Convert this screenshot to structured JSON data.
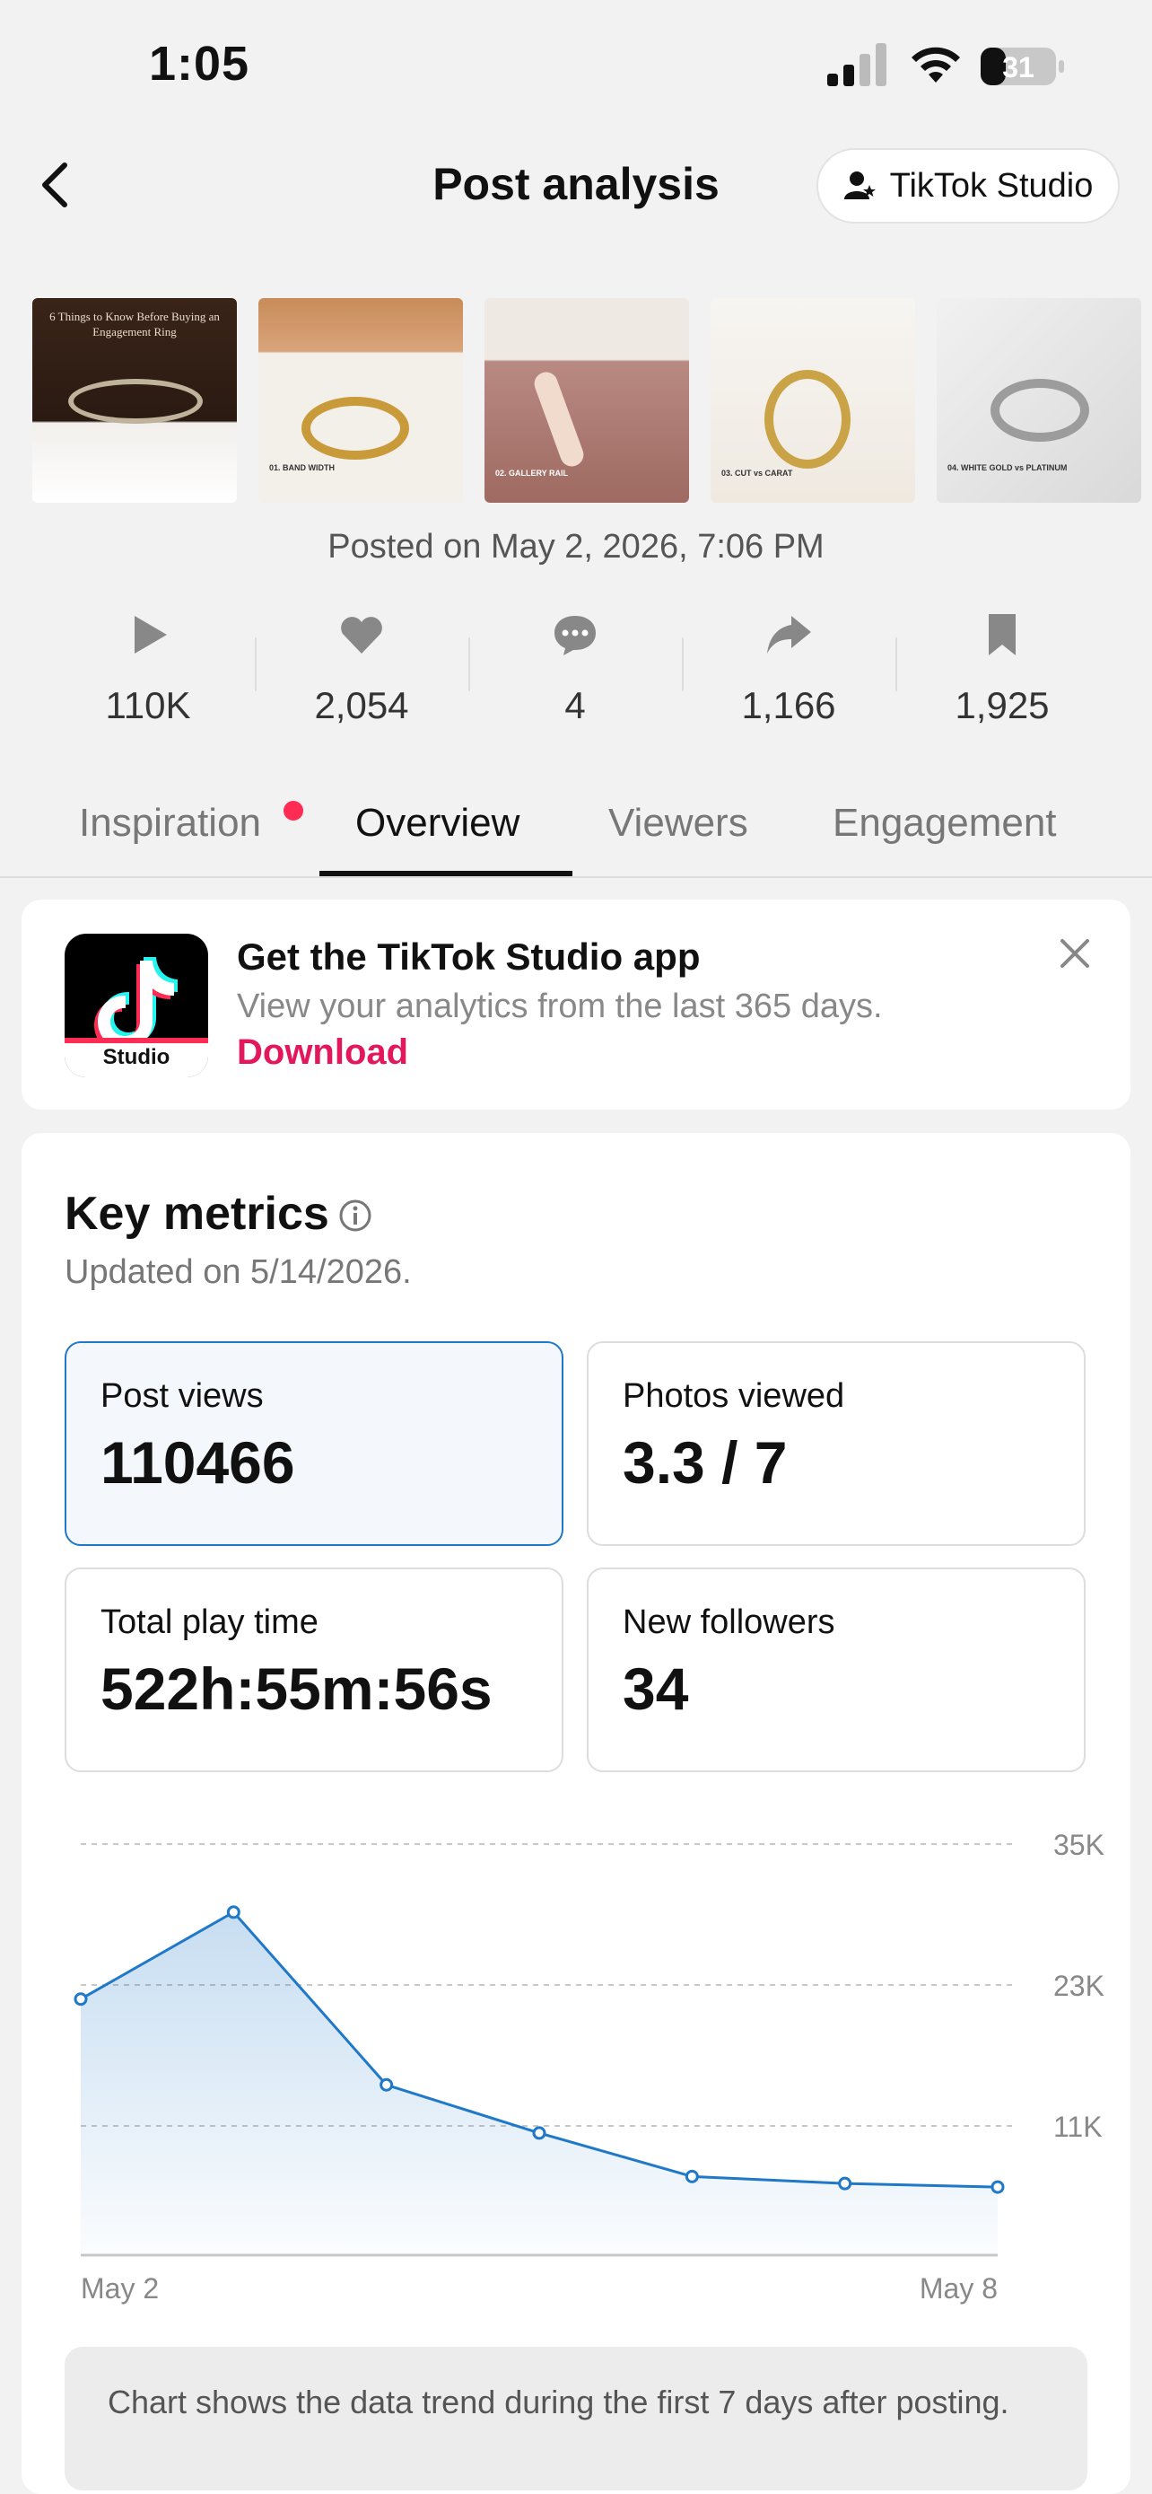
{
  "status_bar": {
    "time": "1:05",
    "battery": "31"
  },
  "header": {
    "title": "Post analysis",
    "studio_button": "TikTok Studio"
  },
  "thumbnails": [
    {
      "caption": "6 Things to Know Before Buying an Engagement Ring"
    },
    {
      "caption": "01. BAND WIDTH"
    },
    {
      "caption": "02. GALLERY RAIL"
    },
    {
      "caption": "03. CUT vs CARAT"
    },
    {
      "caption": "04. WHITE GOLD vs PLATINUM"
    }
  ],
  "posted": "Posted on May 2, 2026, 7:06 PM",
  "stats": [
    {
      "icon": "play-icon",
      "value": "110K"
    },
    {
      "icon": "heart-icon",
      "value": "2,054"
    },
    {
      "icon": "comment-icon",
      "value": "4"
    },
    {
      "icon": "share-icon",
      "value": "1,166"
    },
    {
      "icon": "bookmark-icon",
      "value": "1,925"
    }
  ],
  "tabs": [
    {
      "label": "Inspiration",
      "active": false,
      "badge": true
    },
    {
      "label": "Overview",
      "active": true
    },
    {
      "label": "Viewers",
      "active": false
    },
    {
      "label": "Engagement",
      "active": false
    }
  ],
  "promo": {
    "title": "Get the TikTok Studio app",
    "subtitle": "View your analytics from the last 365 days.",
    "link": "Download",
    "app_label": "Studio"
  },
  "key_metrics": {
    "title": "Key metrics",
    "updated": "Updated on 5/14/2026.",
    "boxes": [
      {
        "label": "Post views",
        "value": "110466",
        "selected": true
      },
      {
        "label": "Photos viewed",
        "value": "3.3 / 7"
      },
      {
        "label": "Total play time",
        "value": "522h:55m:56s"
      },
      {
        "label": "New followers",
        "value": "34"
      }
    ],
    "note": "Chart shows the data trend during the first 7 days after posting."
  },
  "chart_data": {
    "type": "area",
    "x": [
      "May 2",
      "May 3",
      "May 4",
      "May 5",
      "May 6",
      "May 7",
      "May 8"
    ],
    "x_tick_labels": [
      "May 2",
      "May 8"
    ],
    "values": [
      21800,
      29200,
      14500,
      10400,
      6700,
      6100,
      5800
    ],
    "y_ticks": [
      {
        "v": 11000,
        "label": "11K"
      },
      {
        "v": 23000,
        "label": "23K"
      },
      {
        "v": 35000,
        "label": "35K"
      }
    ],
    "ylim": [
      0,
      35000
    ],
    "color": "#1f78c8",
    "grid": true
  }
}
